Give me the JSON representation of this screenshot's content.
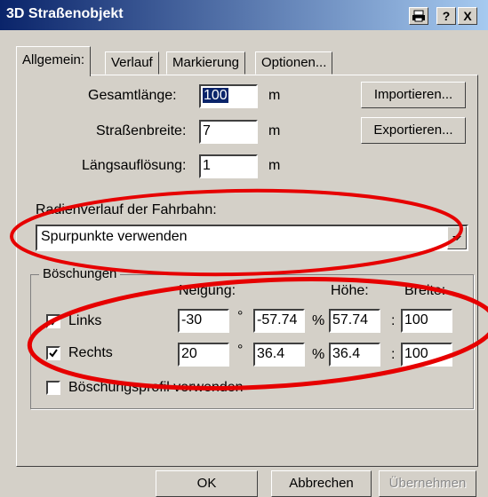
{
  "window": {
    "title": "3D Straßenobjekt"
  },
  "titlebar_buttons": {
    "print_icon": "printer-icon",
    "help": "?",
    "close": "X"
  },
  "tabs": [
    {
      "label": "Allgemein:",
      "active": true
    },
    {
      "label": "Verlauf",
      "active": false
    },
    {
      "label": "Markierung",
      "active": false
    },
    {
      "label": "Optionen...",
      "active": false
    }
  ],
  "general": {
    "total_length": {
      "label": "Gesamtlänge:",
      "value": "100",
      "unit": "m"
    },
    "road_width": {
      "label": "Straßenbreite:",
      "value": "7",
      "unit": "m"
    },
    "resolution": {
      "label": "Längsauflösung:",
      "value": "1",
      "unit": "m"
    },
    "import_button": "Importieren...",
    "export_button": "Exportieren..."
  },
  "radius": {
    "label": "Radienverlauf der Fahrbahn:",
    "selected": "Spurpunkte verwenden"
  },
  "embankments": {
    "title": "Böschungen",
    "headers": {
      "slope": "Neigung:",
      "height": "Höhe:",
      "width": "Breite:"
    },
    "rows": [
      {
        "label": "Links",
        "checked": true,
        "slope_deg": "-30",
        "slope_pct": "-57.74",
        "height": "57.74",
        "width": "100"
      },
      {
        "label": "Rechts",
        "checked": true,
        "slope_deg": "20",
        "slope_pct": "36.4",
        "height": "36.4",
        "width": "100"
      }
    ],
    "degree_symbol": "°",
    "percent_symbol": "%",
    "colon": ":",
    "profile_checkbox": {
      "label": "Böschungsprofil verwenden",
      "checked": false
    }
  },
  "footer": {
    "ok": "OK",
    "cancel": "Abbrechen",
    "apply": "Übernehmen"
  },
  "annotation_color": "#e60000"
}
